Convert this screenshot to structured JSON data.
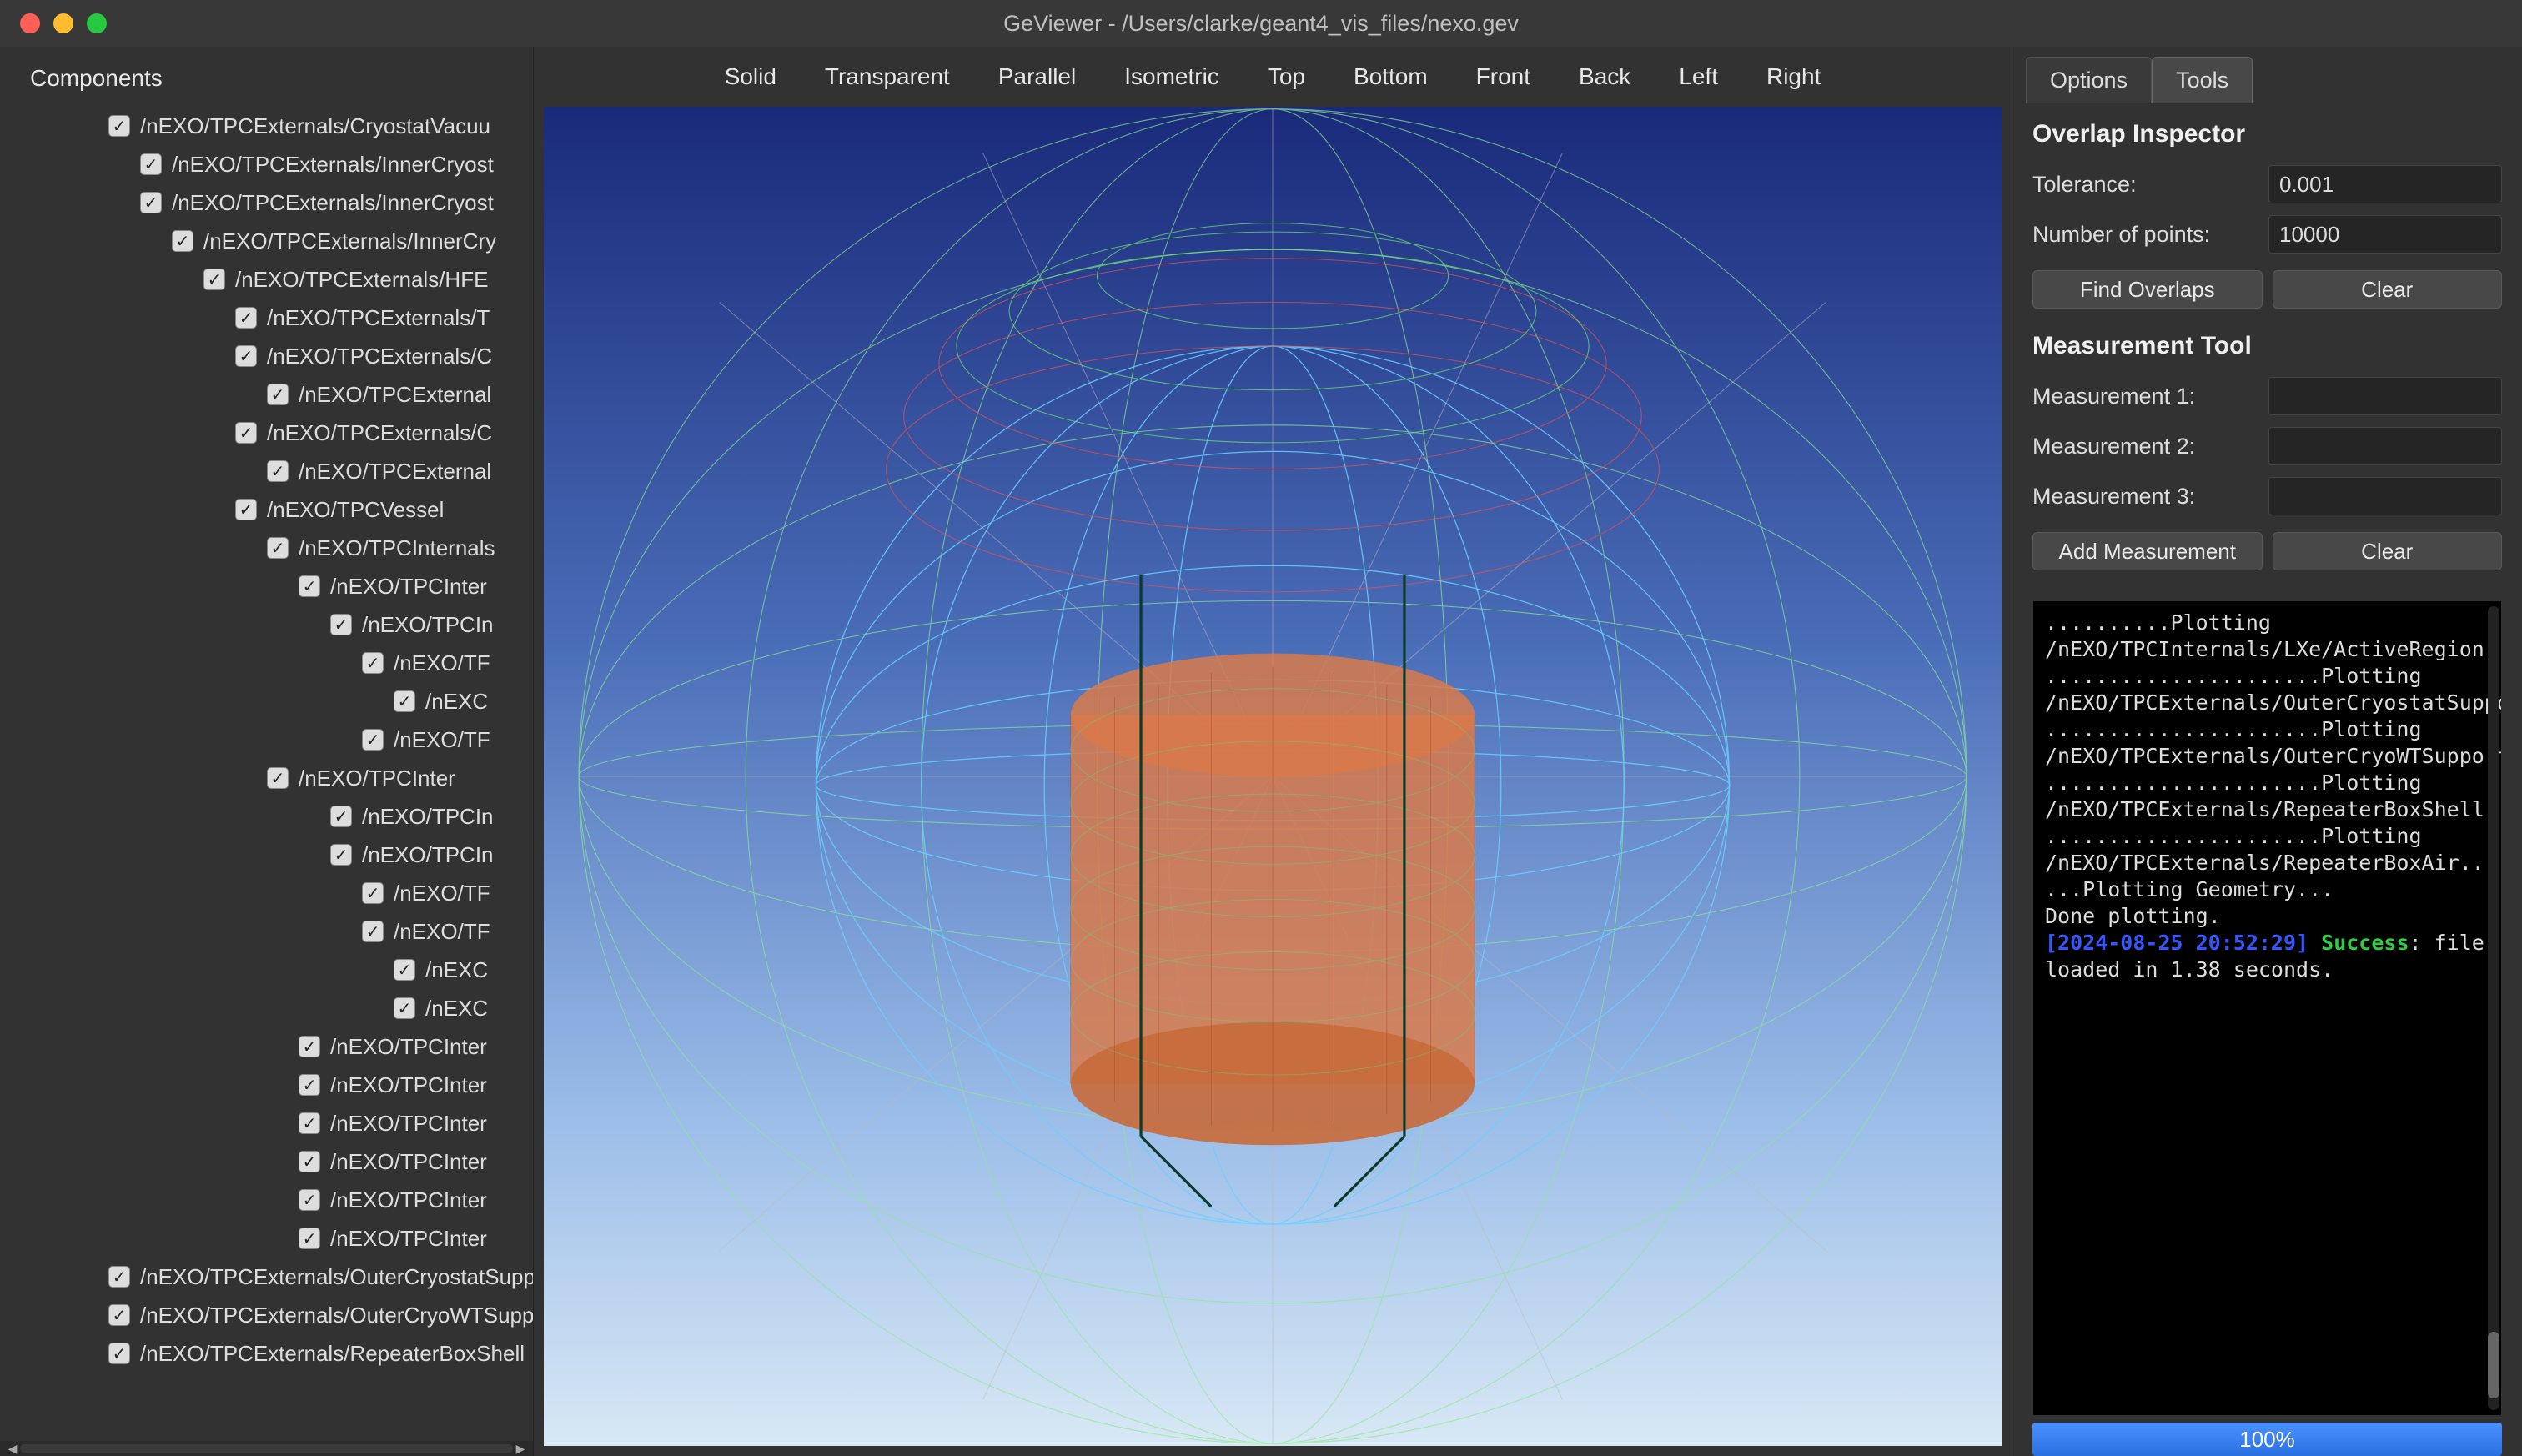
{
  "title": "GeViewer - /Users/clarke/geant4_vis_files/nexo.gev",
  "componentsHeader": "Components",
  "tree": [
    {
      "indent": 0,
      "label": "/nEXO/TPCExternals/CryostatVacuu"
    },
    {
      "indent": 1,
      "label": "/nEXO/TPCExternals/InnerCryost"
    },
    {
      "indent": 1,
      "label": "/nEXO/TPCExternals/InnerCryost"
    },
    {
      "indent": 2,
      "label": "/nEXO/TPCExternals/InnerCry"
    },
    {
      "indent": 3,
      "label": "/nEXO/TPCExternals/HFE"
    },
    {
      "indent": 4,
      "label": "/nEXO/TPCExternals/T"
    },
    {
      "indent": 4,
      "label": "/nEXO/TPCExternals/C"
    },
    {
      "indent": 5,
      "label": "/nEXO/TPCExternal"
    },
    {
      "indent": 4,
      "label": "/nEXO/TPCExternals/C"
    },
    {
      "indent": 5,
      "label": "/nEXO/TPCExternal"
    },
    {
      "indent": 4,
      "label": "/nEXO/TPCVessel"
    },
    {
      "indent": 5,
      "label": "/nEXO/TPCInternals"
    },
    {
      "indent": 6,
      "label": "/nEXO/TPCInter"
    },
    {
      "indent": 7,
      "label": "/nEXO/TPCIn"
    },
    {
      "indent": 8,
      "label": "/nEXO/TF"
    },
    {
      "indent": 9,
      "label": "/nEXC"
    },
    {
      "indent": 8,
      "label": "/nEXO/TF"
    },
    {
      "indent": 5,
      "label": "/nEXO/TPCInter"
    },
    {
      "indent": 7,
      "label": "/nEXO/TPCIn"
    },
    {
      "indent": 7,
      "label": "/nEXO/TPCIn"
    },
    {
      "indent": 8,
      "label": "/nEXO/TF"
    },
    {
      "indent": 8,
      "label": "/nEXO/TF"
    },
    {
      "indent": 9,
      "label": "/nEXC"
    },
    {
      "indent": 9,
      "label": "/nEXC"
    },
    {
      "indent": 6,
      "label": "/nEXO/TPCInter"
    },
    {
      "indent": 6,
      "label": "/nEXO/TPCInter"
    },
    {
      "indent": 6,
      "label": "/nEXO/TPCInter"
    },
    {
      "indent": 6,
      "label": "/nEXO/TPCInter"
    },
    {
      "indent": 6,
      "label": "/nEXO/TPCInter"
    },
    {
      "indent": 6,
      "label": "/nEXO/TPCInter"
    },
    {
      "indent": 0,
      "label": "/nEXO/TPCExternals/OuterCryostatSuppor"
    },
    {
      "indent": 0,
      "label": "/nEXO/TPCExternals/OuterCryoWTSupport"
    },
    {
      "indent": 0,
      "label": "/nEXO/TPCExternals/RepeaterBoxShell"
    }
  ],
  "viewModes": [
    "Solid",
    "Transparent",
    "Parallel",
    "Isometric",
    "Top",
    "Bottom",
    "Front",
    "Back",
    "Left",
    "Right"
  ],
  "tabs": {
    "options": "Options",
    "tools": "Tools"
  },
  "overlap": {
    "title": "Overlap Inspector",
    "toleranceLabel": "Tolerance:",
    "toleranceValue": "0.001",
    "pointsLabel": "Number of points:",
    "pointsValue": "10000",
    "findBtn": "Find Overlaps",
    "clearBtn": "Clear"
  },
  "measurement": {
    "title": "Measurement Tool",
    "m1Label": "Measurement 1:",
    "m2Label": "Measurement 2:",
    "m3Label": "Measurement 3:",
    "m1Value": "",
    "m2Value": "",
    "m3Value": "",
    "addBtn": "Add Measurement",
    "clearBtn": "Clear"
  },
  "console": {
    "lines": [
      "..........Plotting /nEXO/TPCInternals/LXe/ActiveRegion...",
      "",
      "......................Plotting /nEXO/TPCExternals/OuterCryostatSupport...",
      "",
      "......................Plotting /nEXO/TPCExternals/OuterCryoWTSupport...",
      "",
      "......................Plotting /nEXO/TPCExternals/RepeaterBoxShell...",
      "",
      "......................Plotting /nEXO/TPCExternals/RepeaterBoxAir...",
      "",
      "...Plotting Geometry...",
      "",
      "Done plotting.",
      ""
    ],
    "timestamp": "[2024-08-25 20:52:29]",
    "successWord": "Success",
    "successTail": ": file loaded in 1.38 seconds."
  },
  "progress": "100%"
}
